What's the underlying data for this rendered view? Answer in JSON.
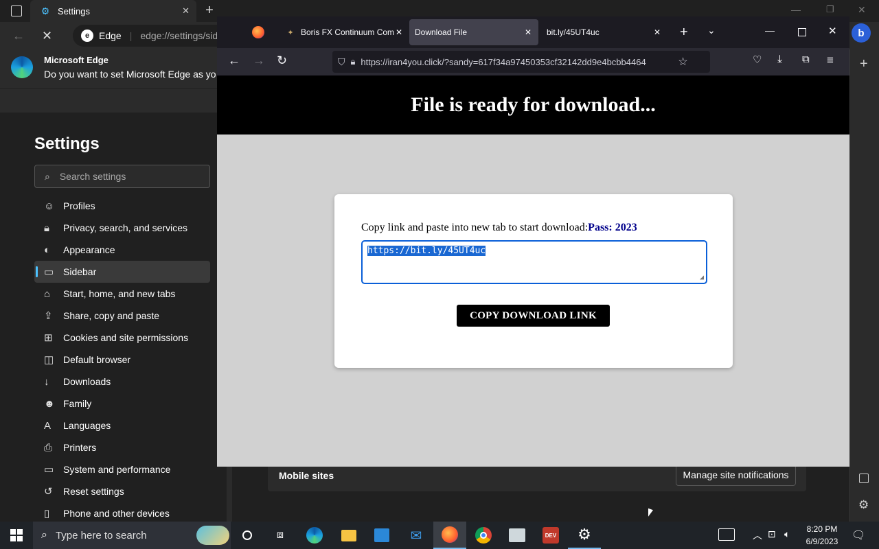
{
  "edge": {
    "tab_title": "Settings",
    "edge_label": "Edge",
    "url": "edge://settings/sid",
    "info_title": "Microsoft Edge",
    "info_text": "Do you want to set Microsoft Edge as yo",
    "settings_title": "Settings",
    "search_placeholder": "Search settings",
    "menu": [
      {
        "label": "Profiles",
        "icon": "profile-icon"
      },
      {
        "label": "Privacy, search, and services",
        "icon": "lock-icon"
      },
      {
        "label": "Appearance",
        "icon": "appearance-icon"
      },
      {
        "label": "Sidebar",
        "icon": "sidebar-icon"
      },
      {
        "label": "Start, home, and new tabs",
        "icon": "home-icon"
      },
      {
        "label": "Share, copy and paste",
        "icon": "share-icon"
      },
      {
        "label": "Cookies and site permissions",
        "icon": "cookies-icon"
      },
      {
        "label": "Default browser",
        "icon": "browser-icon"
      },
      {
        "label": "Downloads",
        "icon": "download-icon"
      },
      {
        "label": "Family",
        "icon": "family-icon"
      },
      {
        "label": "Languages",
        "icon": "languages-icon"
      },
      {
        "label": "Printers",
        "icon": "printer-icon"
      },
      {
        "label": "System and performance",
        "icon": "system-icon"
      },
      {
        "label": "Reset settings",
        "icon": "reset-icon"
      },
      {
        "label": "Phone and other devices",
        "icon": "phone-icon"
      }
    ],
    "active_item": "Sidebar",
    "mobile_sites_label": "Mobile sites",
    "manage_notifications_label": "Manage site notifications"
  },
  "firefox": {
    "tabs": [
      {
        "label": "Boris FX Continuum Com",
        "icon": "boris-fx-icon"
      },
      {
        "label": "Download File",
        "active": true
      },
      {
        "label": "bit.ly/45UT4uc"
      }
    ],
    "url": "https://iran4you.click/?sandy=617f34a97450353cf32142dd9e4bcbb4464"
  },
  "page": {
    "header": "File is ready for download...",
    "instruction": "Copy link and paste into new tab to start download:",
    "pass": "Pass: 2023",
    "link": "https://bit.ly/45UT4uc",
    "button": "COPY DOWNLOAD LINK"
  },
  "taskbar": {
    "search_placeholder": "Type here to search",
    "time": "8:20 PM",
    "date": "6/9/2023"
  },
  "colors": {
    "accent": "#4cc2ff",
    "page_header_bg": "#000000",
    "page_body_bg": "#d1d1d1",
    "pass_color": "#00008b",
    "selection": "#1967d2"
  }
}
